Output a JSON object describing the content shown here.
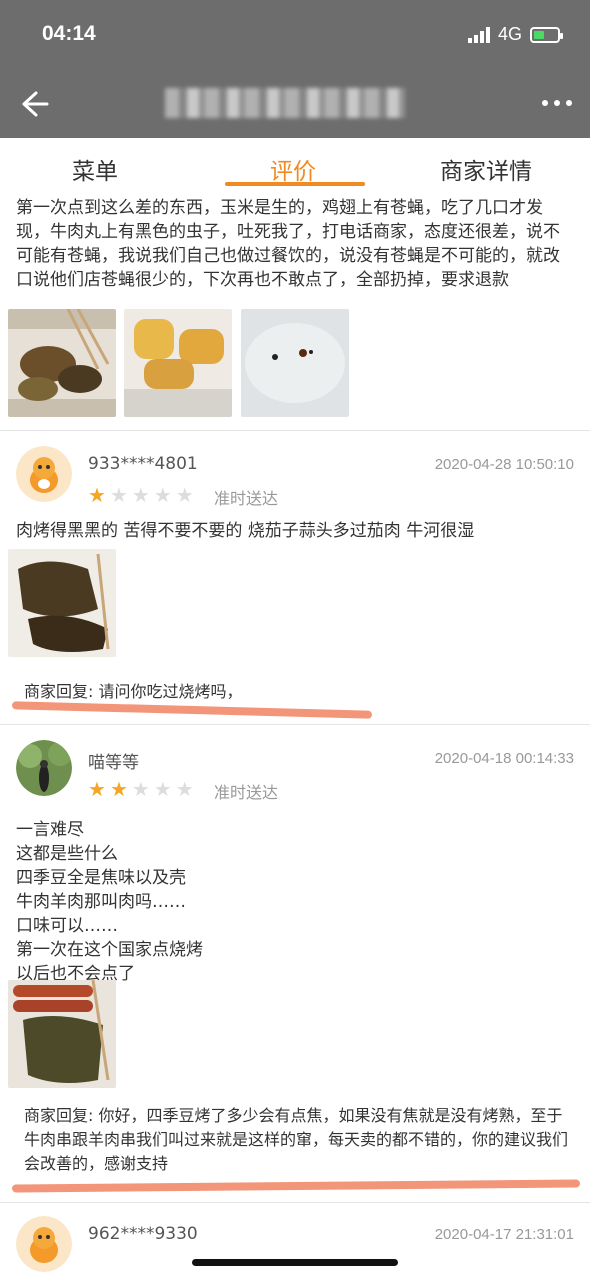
{
  "status": {
    "time": "04:14",
    "network": "4G"
  },
  "header": {
    "back": "back",
    "more": "more"
  },
  "tabs": [
    {
      "label": "菜单"
    },
    {
      "label": "评价"
    },
    {
      "label": "商家详情"
    }
  ],
  "colors": {
    "accent": "#f08a22",
    "star": "#f5a623",
    "topbar": "#6d6d6d"
  },
  "reviews": [
    {
      "partial_text": "第一次点到这么差的东西，玉米是生的，鸡翅上有苍蝇，吃了几口才发现，牛肉丸上有黑色的虫子，吐死我了，打电话商家，态度还很差，说不可能有苍蝇，我说我们自己也做过餐饮的，说没有苍蝇是不可能的，就改口说他们店苍蝇很少的，下次再也不敢点了，全部扔掉，要求退款"
    },
    {
      "user": "933****4801",
      "date": "2020-04-28 10:50:10",
      "rating": 1,
      "delivery": "准时送达",
      "text": "肉烤得黑黑的 苦得不要不要的 烧茄子蒜头多过茄肉 牛河很湿",
      "reply": "商家回复: 请问你吃过烧烤吗，"
    },
    {
      "user": "喵等等",
      "date": "2020-04-18 00:14:33",
      "rating": 2,
      "delivery": "准时送达",
      "lines": [
        "一言难尽",
        "这都是些什么",
        "四季豆全是焦味以及壳",
        "牛肉羊肉那叫肉吗……",
        "口味可以……",
        "第一次在这个国家点烧烤",
        "以后也不会点了"
      ],
      "reply": "商家回复: 你好，四季豆烤了多少会有点焦，如果没有焦就是没有烤熟，至于牛肉串跟羊肉串我们叫过来就是这样的窜，每天卖的都不错的，你的建议我们会改善的，感谢支持"
    },
    {
      "user": "962****9330",
      "date": "2020-04-17 21:31:01"
    }
  ]
}
